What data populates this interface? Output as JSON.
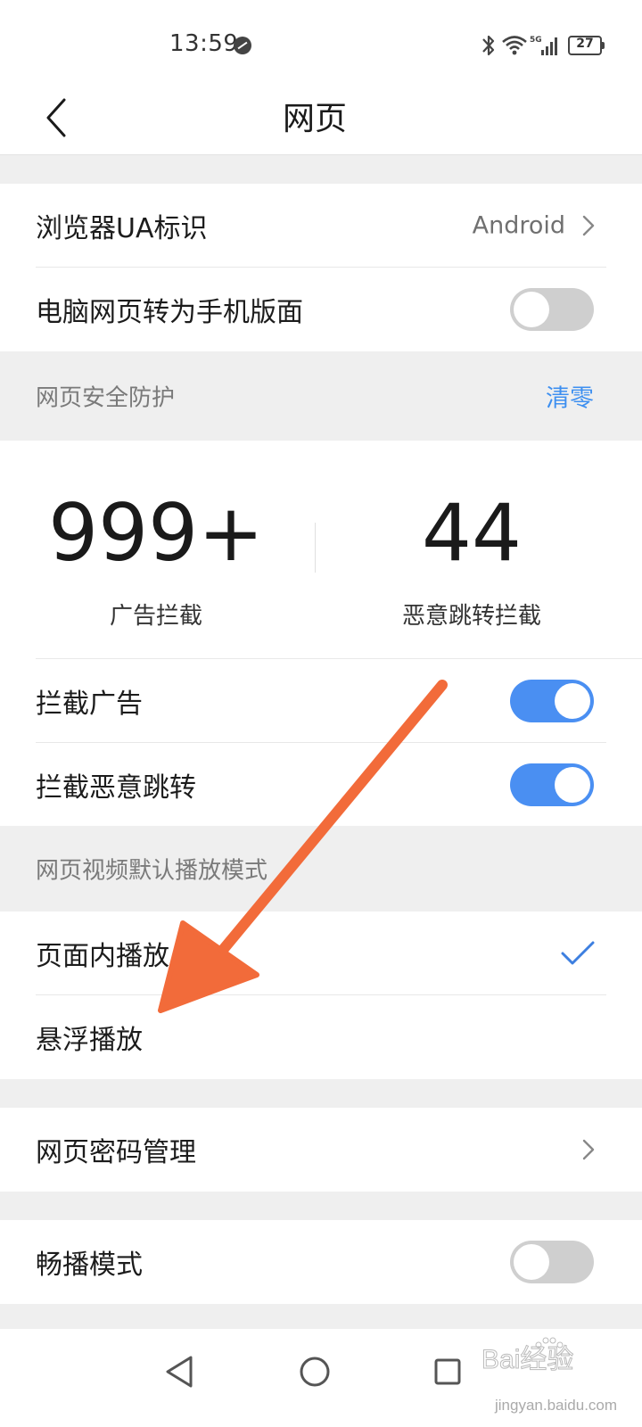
{
  "status_bar": {
    "time": "13:59",
    "network": "5G",
    "battery": "27"
  },
  "header": {
    "title": "网页"
  },
  "settings": {
    "browser_ua": {
      "label": "浏览器UA标识",
      "value": "Android"
    },
    "mobile_layout": {
      "label": "电脑网页转为手机版面",
      "enabled": false
    }
  },
  "security": {
    "title": "网页安全防护",
    "action": "清零",
    "ads_blocked": {
      "count": "999+",
      "label": "广告拦截"
    },
    "redirects_blocked": {
      "count": "44",
      "label": "恶意跳转拦截"
    },
    "block_ads": {
      "label": "拦截广告",
      "enabled": true
    },
    "block_redirects": {
      "label": "拦截恶意跳转",
      "enabled": true
    }
  },
  "video_mode": {
    "title": "网页视频默认播放模式",
    "options": [
      {
        "label": "页面内播放",
        "selected": true
      },
      {
        "label": "悬浮播放",
        "selected": false
      }
    ]
  },
  "password_manager": {
    "label": "网页密码管理"
  },
  "smooth_mode": {
    "label": "畅播模式",
    "enabled": false
  },
  "colors": {
    "accent": "#4a8ff2",
    "link": "#3d8ff0",
    "annotation_arrow": "#f26b3a"
  },
  "watermark": {
    "brand": "Bai经验",
    "url": "jingyan.baidu.com"
  }
}
